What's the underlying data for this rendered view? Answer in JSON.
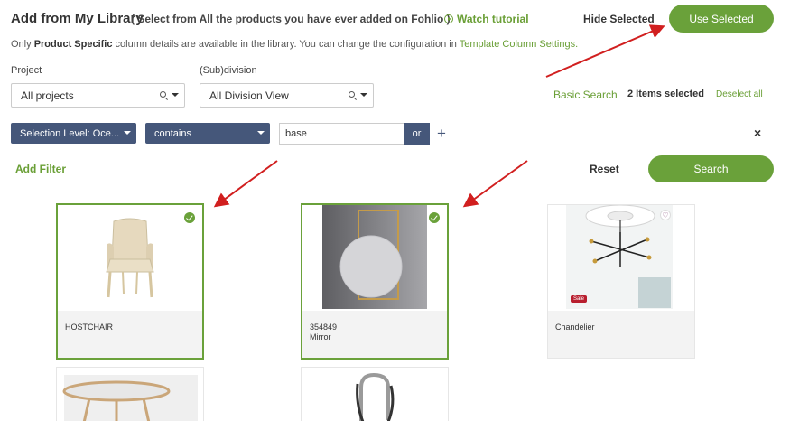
{
  "header": {
    "title": "Add from My Library",
    "subtitle": "( Select from All the products you have ever added on Fohlio )",
    "watch_tutorial": "Watch tutorial",
    "hide_selected": "Hide Selected",
    "use_selected": "Use Selected"
  },
  "info": {
    "prefix": "Only ",
    "bold": "Product Specific",
    "text": " column details are available in the library. You can change the configuration in ",
    "link": "Template Column Settings."
  },
  "filters": {
    "project_label": "Project",
    "project_value": "All projects",
    "subdivision_label": "(Sub)division",
    "subdivision_value": "All Division View",
    "basic_search": "Basic Search",
    "items_selected": "2 Items selected",
    "deselect_all": "Deselect all",
    "selection_level": "Selection Level: Oce...",
    "operator": "contains",
    "value": "base",
    "or_label": "or",
    "plus": "+",
    "close": "×",
    "add_filter": "Add Filter",
    "reset": "Reset",
    "search": "Search"
  },
  "products": [
    {
      "name": "HOSTCHAIR",
      "line2": "",
      "selected": true
    },
    {
      "name": "354849",
      "line2": "Mirror",
      "selected": true
    },
    {
      "name": "Chandelier",
      "line2": "",
      "selected": false,
      "badge": "Sale",
      "favorite_icon": "heart-icon"
    },
    {
      "name": "",
      "line2": ""
    },
    {
      "name": "",
      "line2": ""
    }
  ],
  "colors": {
    "accent_green": "#6aa13a",
    "filter_navy": "#45577a",
    "annotation_red": "#d11f1f"
  }
}
